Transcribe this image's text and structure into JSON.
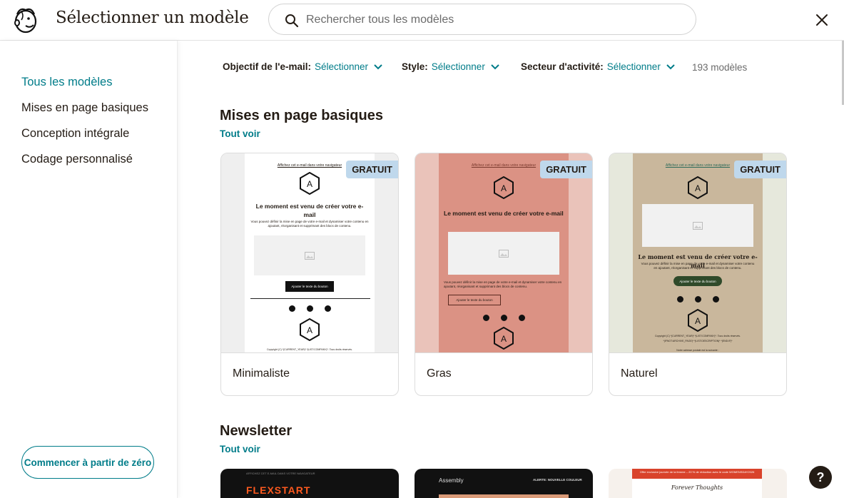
{
  "header": {
    "title": "Sélectionner un modèle",
    "search_placeholder": "Rechercher tous les modèles"
  },
  "sidebar": {
    "items": [
      {
        "label": "Tous les modèles"
      },
      {
        "label": "Mises en page basiques"
      },
      {
        "label": "Conception intégrale"
      },
      {
        "label": "Codage personnalisé"
      }
    ],
    "start_button": "Commencer à partir de zéro"
  },
  "filters": [
    {
      "label": "Objectif de l'e-mail:",
      "value": "Sélectionner"
    },
    {
      "label": "Style:",
      "value": "Sélectionner"
    },
    {
      "label": "Secteur d'activité:",
      "value": "Sélectionner"
    }
  ],
  "count": "193 modèles",
  "sections": [
    {
      "title": "Mises en page basiques",
      "see_all": "Tout voir",
      "templates": [
        {
          "name": "Minimaliste",
          "badge": "GRATUIT",
          "preview": {
            "link": "Affichez cet e-mail dans votre navigateur",
            "headline": "Le moment est venu de créer votre e-mail",
            "body": "Vous pouvez définir la mise en page de votre e-mail et dynamiser votre contenu en ajoutant, réorganisant et supprimant des blocs de contenu.",
            "button": "Ajouter le texte du bouton",
            "logo": "A",
            "footer": "Copyright (C) *|CURRENT_YEAR|* *|LIST:COMPANY|*. Tous droits réservés."
          }
        },
        {
          "name": "Gras",
          "badge": "GRATUIT",
          "preview": {
            "link": "Affichez cet e-mail dans votre navigateur",
            "headline": "Le moment est venu de créer votre e-mail",
            "body": "Vous pouvez définir la mise en page de votre e-mail et dynamiser votre contenu en ajoutant, réorganisant et supprimant des blocs de contenu.",
            "button": "Ajouter le texte du bouton",
            "logo": "A"
          }
        },
        {
          "name": "Naturel",
          "badge": "GRATUIT",
          "preview": {
            "link": "Affichez cet e-mail dans votre navigateur",
            "headline": "Le moment est venu de créer votre e-mail",
            "body": "Vous pouvez définir la mise en page de votre e-mail et dynamiser votre contenu en ajoutant, réorganisant et supprimant des blocs de contenu.",
            "button": "Ajouter le texte du bouton",
            "logo": "A",
            "footer": "Copyright (C) *|CURRENT_YEAR|* *|LIST:COMPANY|*. Tous droits réservés.",
            "footer2": "*|IFNOT:ARCHIVE_PAGE|* *|LIST:DESCRIPTION|* *|END:IF|*",
            "footer3": "Notre adresse postale est la suivante :"
          }
        }
      ]
    },
    {
      "title": "Newsletter",
      "see_all": "Tout voir",
      "templates": [
        {
          "preview_label": "FLEXSTART",
          "top_line": "AFFICHEZ CET E-MAIL DANS VOTRE NAVIGATEUR"
        },
        {
          "preview_label": "Assembly",
          "top_line": "ALERTE: NOUVELLE COULEUR"
        },
        {
          "preview_label": "Forever Thoughts",
          "top_line": "Offre exclusive journée de la femme – 20 % de réduction avec le code WOMENSDAY2026"
        }
      ]
    }
  ],
  "colors": {
    "accent": "#007c89",
    "badge": "#bfd8ec",
    "text": "#241c15"
  }
}
